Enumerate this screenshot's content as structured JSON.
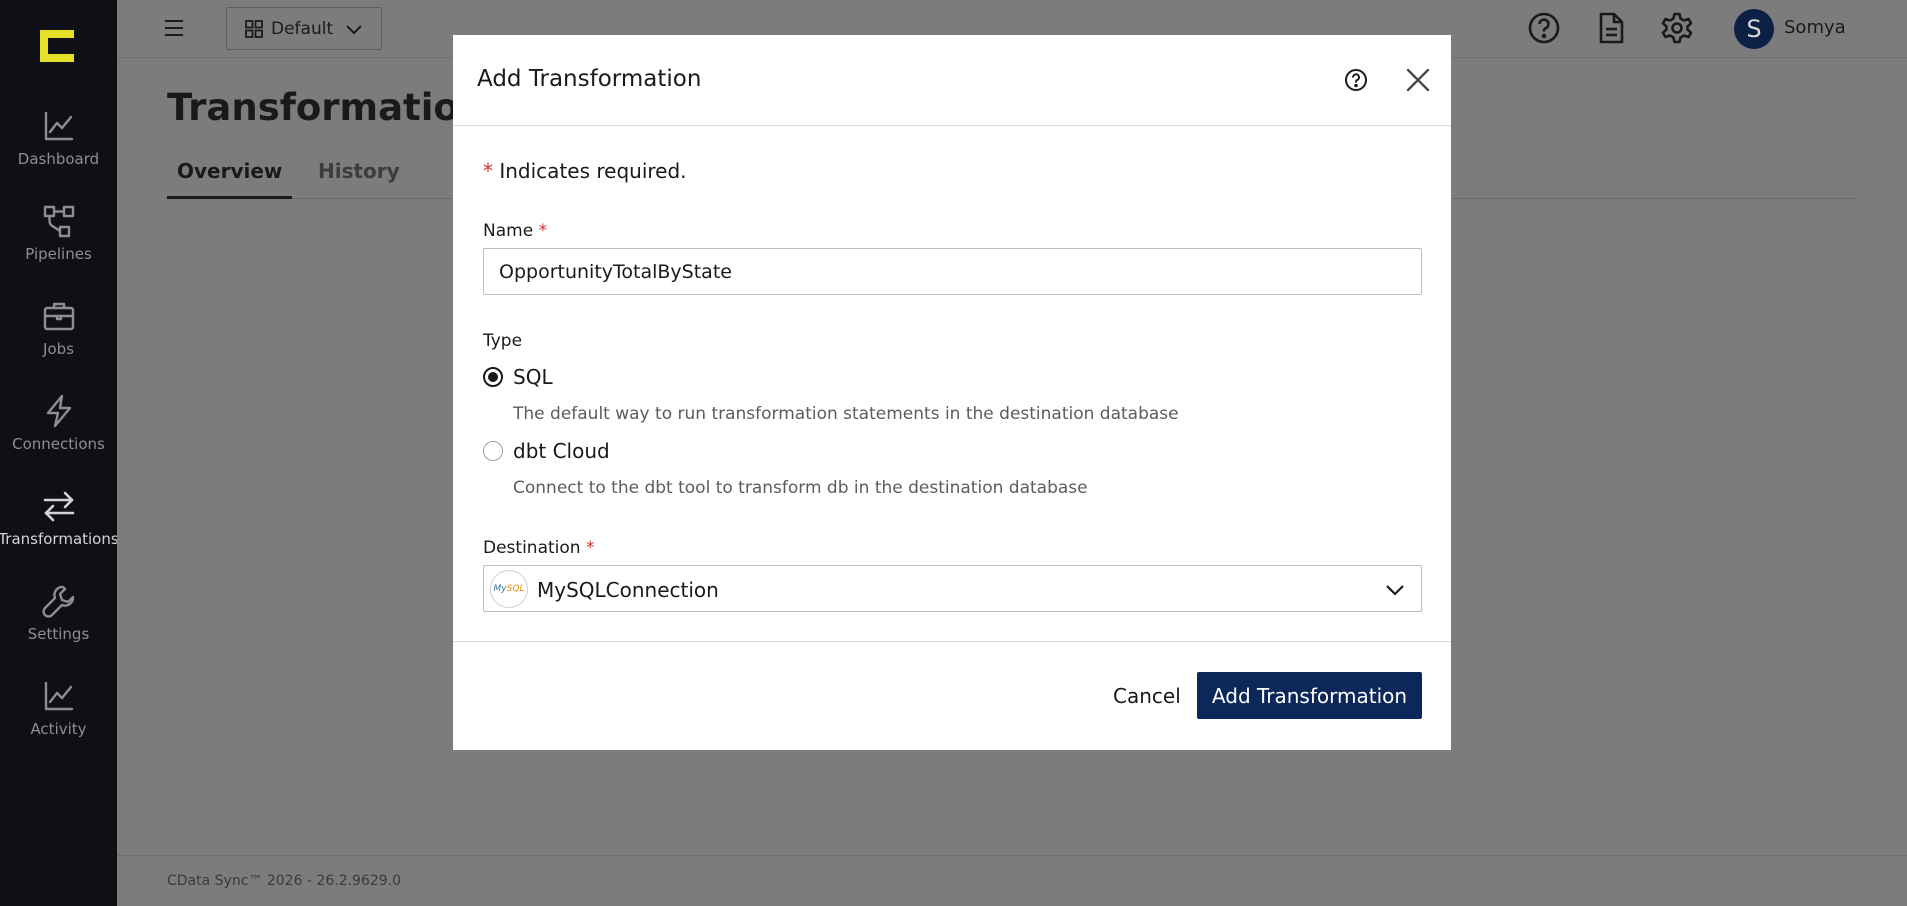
{
  "app": {
    "workspace": "Default",
    "user_initial": "S",
    "user_name": "Somya",
    "footer": "CData Sync™ 2026 - 26.2.9629.0"
  },
  "sidebar": {
    "items": [
      {
        "label": "Dashboard",
        "icon": "line-chart-icon"
      },
      {
        "label": "Pipelines",
        "icon": "pipelines-icon"
      },
      {
        "label": "Jobs",
        "icon": "briefcase-icon"
      },
      {
        "label": "Connections",
        "icon": "lightning-icon"
      },
      {
        "label": "Transformations",
        "icon": "swap-arrows-icon",
        "active": true
      },
      {
        "label": "Settings",
        "icon": "wrench-icon"
      },
      {
        "label": "Activity",
        "icon": "activity-chart-icon"
      }
    ]
  },
  "page": {
    "title": "Transformations",
    "tabs": [
      {
        "label": "Overview",
        "active": true
      },
      {
        "label": "History",
        "active": false
      }
    ]
  },
  "modal": {
    "title": "Add Transformation",
    "required_note": "Indicates required.",
    "required_mark": "*",
    "name_label": "Name",
    "name_value": "OpportunityTotalByState",
    "type_label": "Type",
    "type_options": [
      {
        "label": "SQL",
        "description": "The default way to run transformation statements in the destination database",
        "selected": true
      },
      {
        "label": "dbt Cloud",
        "description": "Connect to the dbt tool to transform db in the destination database",
        "selected": false
      }
    ],
    "destination_label": "Destination",
    "destination_value": "MySQLConnection",
    "destination_logo_text_my": "My",
    "destination_logo_text_sql": "SQL",
    "cancel_label": "Cancel",
    "submit_label": "Add Transformation"
  },
  "colors": {
    "sidebar_bg": "#0f1016",
    "primary": "#0c2759",
    "required": "#d0312d",
    "overlay": "#7c7c7c"
  }
}
